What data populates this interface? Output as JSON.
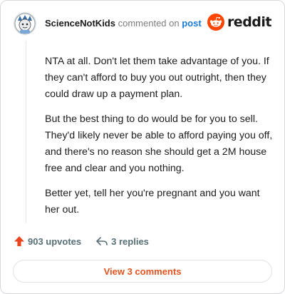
{
  "header": {
    "username": "ScienceNotKids",
    "action_text": "commented on",
    "target_link": "post",
    "brand_name": "reddit"
  },
  "comment": {
    "paragraphs": [
      "NTA at all. Don't let them take advantage of you. If they can't afford to buy you out outright, then they could draw up a payment plan.",
      "But the best thing to do would be for you to sell. They'd likely never be able to afford paying you off, and there's no reason she should get a 2M house free and clear and you nothing.",
      "Better yet, tell her you're pregnant and you want her out."
    ]
  },
  "footer": {
    "upvotes": "903 upvotes",
    "replies": "3 replies"
  },
  "actions": {
    "view_comments_label": "View 3 comments"
  },
  "colors": {
    "brand_orange": "#ff4500",
    "upvote_color": "#e8461e",
    "link_blue": "#1a7bd6",
    "button_text": "#e0541f"
  },
  "icons": {
    "upvote": "upvote-arrow-icon",
    "reply": "reply-arrow-icon",
    "brand": "reddit-snoo-icon"
  }
}
